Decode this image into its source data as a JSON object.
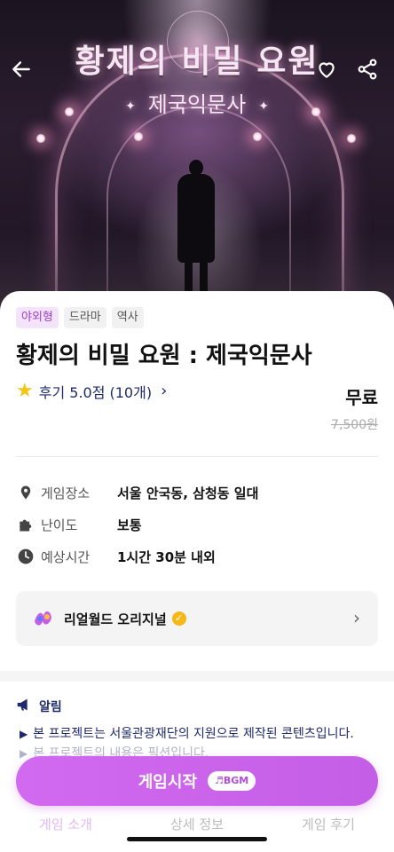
{
  "hero": {
    "title": "황제의 비밀 요원",
    "subtitle": "제국익문사",
    "dot_left": "✦",
    "dot_right": "✦"
  },
  "header": {
    "back_icon": "back-arrow-icon",
    "like_icon": "heart-icon",
    "share_icon": "share-icon"
  },
  "tags": [
    "야외형",
    "드라마",
    "역사"
  ],
  "game": {
    "title": "황제의 비밀 요원 : 제국익문사",
    "review_text": "후기 5.0점 (10개)",
    "price": "무료",
    "original_price": "7,500원"
  },
  "info": [
    {
      "icon": "location-icon",
      "label": "게임장소",
      "value": "서울 안국동, 삼청동 일대"
    },
    {
      "icon": "puzzle-icon",
      "label": "난이도",
      "value": "보통"
    },
    {
      "icon": "clock-icon",
      "label": "예상시간",
      "value": "1시간 30분 내외"
    }
  ],
  "original_card": {
    "label": "리얼월드 오리지널",
    "badge": "✓"
  },
  "notice": {
    "title": "알림",
    "lines": [
      "본 프로젝트는 서울관광재단의 지원으로 제작된 콘텐츠입니다.",
      "본 프로젝트의 내용은 픽션입니다."
    ]
  },
  "tabs": [
    "게임 소개",
    "상세 정보",
    "게임 후기"
  ],
  "start_button": {
    "label": "게임시작",
    "bgm_label": "♬BGM"
  },
  "colors": {
    "accent": "#c45ee6",
    "navy": "#1f2a6a",
    "star": "#f5c518"
  }
}
